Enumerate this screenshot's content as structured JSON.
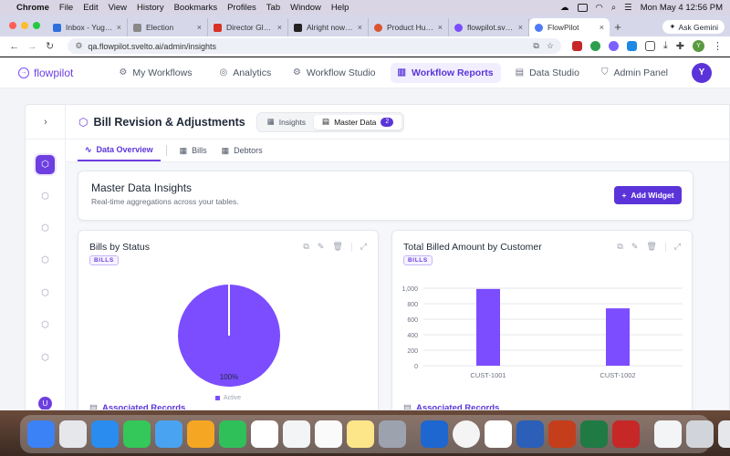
{
  "menubar": {
    "app": "Chrome",
    "items": [
      "File",
      "Edit",
      "View",
      "History",
      "Bookmarks",
      "Profiles",
      "Tab",
      "Window",
      "Help"
    ],
    "clock": "Mon May 4  12:56 PM"
  },
  "browser": {
    "tabs": [
      {
        "label": "Inbox - Yugal Ki",
        "color": "#2f6fdd"
      },
      {
        "label": "Election",
        "color": "#888888"
      },
      {
        "label": "Director Global",
        "color": "#d93025"
      },
      {
        "label": "Alright now we",
        "color": "#222222"
      },
      {
        "label": "Product Hunt –",
        "color": "#da552f"
      },
      {
        "label": "flowpilot.svelto",
        "color": "#7c4dff"
      },
      {
        "label": "FlowPilot",
        "color": "#4f7bf7"
      }
    ],
    "ask_gemini": "Ask Gemini",
    "url": "qa.flowpilot.svelto.ai/admin/insights",
    "profile_initial": "Y"
  },
  "app": {
    "logo": "flowpilot",
    "nav_left": [
      "My Workflows",
      "Analytics"
    ],
    "nav_right": [
      "Workflow Studio",
      "Workflow Reports",
      "Data Studio",
      "Admin Panel"
    ],
    "avatar": "Y",
    "accent": "#5b34d9"
  },
  "page": {
    "title": "Bill Revision & Adjustments",
    "segments": [
      {
        "label": "Insights"
      },
      {
        "label": "Master Data",
        "count": "2"
      }
    ],
    "subtabs": [
      "Data Overview",
      "Bills",
      "Debtors"
    ],
    "rail_badge": "U"
  },
  "insights": {
    "heading": "Master Data Insights",
    "subtitle": "Real-time aggregations across your tables.",
    "add_widget": "Add Widget"
  },
  "cards": [
    {
      "title": "Bills by Status",
      "tag": "BILLS",
      "assoc": "Associated Records",
      "chart_data": {
        "type": "pie",
        "labels": [
          "Active"
        ],
        "values": [
          100
        ],
        "data_labels": [
          "100%"
        ],
        "colors": [
          "#7c4dff"
        ]
      }
    },
    {
      "title": "Total Billed Amount by Customer",
      "tag": "BILLS",
      "assoc": "Associated Records",
      "chart_data": {
        "type": "bar",
        "categories": [
          "CUST-1001",
          "CUST-1002"
        ],
        "values": [
          990,
          740
        ],
        "yticks": [
          "1,000",
          "800",
          "600",
          "400",
          "200",
          "0"
        ],
        "ylim": [
          0,
          1000
        ],
        "color": "#7c4dff"
      }
    }
  ]
}
